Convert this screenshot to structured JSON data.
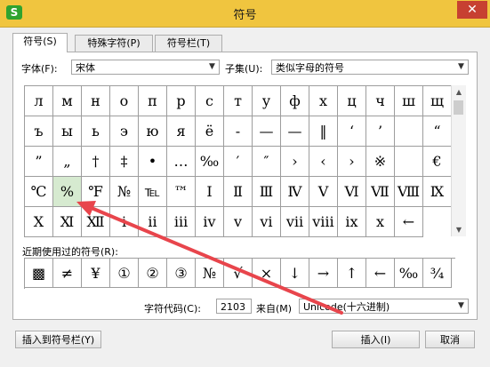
{
  "window": {
    "title": "符号",
    "app_icon": "S",
    "close_glyph": "✕"
  },
  "tabs": [
    {
      "label": "符号(S)"
    },
    {
      "label": "特殊字符(P)"
    },
    {
      "label": "符号栏(T)"
    }
  ],
  "font": {
    "label": "字体(F):",
    "value": "宋体"
  },
  "subset": {
    "label": "子集(U):",
    "value": "类似字母的符号"
  },
  "symbols": [
    "л",
    "м",
    "н",
    "о",
    "п",
    "р",
    "с",
    "т",
    "у",
    "ф",
    "х",
    "ц",
    "ч",
    "ш",
    "щ",
    "ъ",
    "ы",
    "ь",
    "э",
    "ю",
    "я",
    "ё",
    "-",
    "—",
    "—",
    "‖",
    "‘",
    "’",
    "",
    "“",
    "”",
    "„",
    "†",
    "‡",
    "•",
    "…",
    "‰",
    "′",
    "″",
    "›",
    "‹",
    "›",
    "※",
    "",
    "€",
    "℃",
    "%",
    "℉",
    "№",
    "℡",
    "™",
    "Ⅰ",
    "Ⅱ",
    "Ⅲ",
    "Ⅳ",
    "Ⅴ",
    "Ⅵ",
    "Ⅶ",
    "Ⅷ",
    "Ⅸ",
    "Ⅹ",
    "Ⅺ",
    "Ⅻ",
    "ⅰ",
    "ⅱ",
    "ⅲ",
    "ⅳ",
    "ⅴ",
    "ⅵ",
    "ⅶ",
    "ⅷ",
    "ⅸ",
    "ⅹ",
    "←"
  ],
  "recent_label": "近期使用过的符号(R):",
  "recent": [
    "▩",
    "≠",
    "¥",
    "①",
    "②",
    "③",
    "№",
    "√",
    "×",
    "↓",
    "→",
    "↑",
    "←",
    "‰",
    "¾"
  ],
  "char_code": {
    "label": "字符代码(C):",
    "value": "2103"
  },
  "from": {
    "label": "来自(M)",
    "value": "Unicode(十六进制)"
  },
  "buttons": {
    "insert_to_bar": "插入到符号栏(Y)",
    "insert": "插入(I)",
    "cancel": "取消"
  },
  "annotation_color": "#e8454c"
}
